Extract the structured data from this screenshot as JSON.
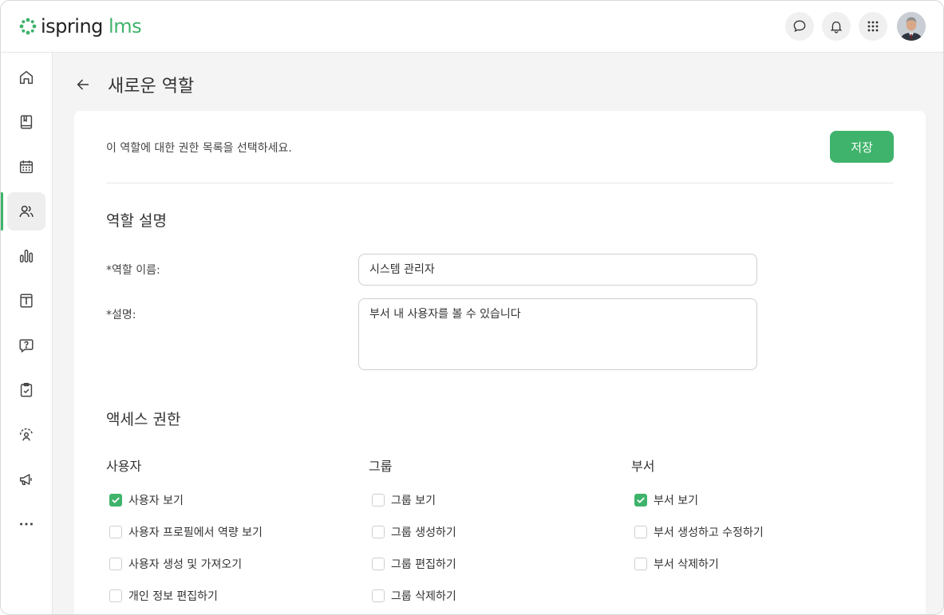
{
  "app": {
    "logo_main": "ispring",
    "logo_accent": "lms"
  },
  "colors": {
    "accent": "#3fb36b"
  },
  "header": {
    "actions": [
      "chat-icon",
      "bell-icon",
      "apps-grid-icon",
      "user-avatar"
    ]
  },
  "sidebar": {
    "items": [
      {
        "icon": "home-icon",
        "active": false
      },
      {
        "icon": "book-icon",
        "active": false
      },
      {
        "icon": "calendar-icon",
        "active": false
      },
      {
        "icon": "users-icon",
        "active": true
      },
      {
        "icon": "bar-chart-icon",
        "active": false
      },
      {
        "icon": "info-catalog-icon",
        "active": false
      },
      {
        "icon": "question-bubble-icon",
        "active": false
      },
      {
        "icon": "clipboard-check-icon",
        "active": false
      },
      {
        "icon": "user-target-icon",
        "active": false
      },
      {
        "icon": "megaphone-icon",
        "active": false
      },
      {
        "icon": "more-icon",
        "active": false
      }
    ]
  },
  "page": {
    "title": "새로운 역할",
    "intro": "이 역할에 대한 권한 목록을 선택하세요.",
    "save_label": "저장"
  },
  "role_description": {
    "section_title": "역할 설명",
    "name_label": "*역할 이름:",
    "name_value": "시스템 관리자",
    "desc_label": "*설명:",
    "desc_value": "부서 내 사용자를 볼 수 있습니다"
  },
  "access": {
    "section_title": "액세스 권한",
    "columns": [
      {
        "title": "사용자",
        "items": [
          {
            "label": "사용자 보기",
            "checked": true
          },
          {
            "label": "사용자 프로필에서 역량 보기",
            "checked": false
          },
          {
            "label": "사용자 생성 및 가져오기",
            "checked": false
          },
          {
            "label": "개인 정보 편집하기",
            "checked": false
          }
        ]
      },
      {
        "title": "그룹",
        "items": [
          {
            "label": "그룹 보기",
            "checked": false
          },
          {
            "label": "그룹 생성하기",
            "checked": false
          },
          {
            "label": "그룹 편집하기",
            "checked": false
          },
          {
            "label": "그룹 삭제하기",
            "checked": false
          }
        ]
      },
      {
        "title": "부서",
        "items": [
          {
            "label": "부서 보기",
            "checked": true
          },
          {
            "label": "부서 생성하고 수정하기",
            "checked": false
          },
          {
            "label": "부서 삭제하기",
            "checked": false
          }
        ]
      }
    ]
  }
}
